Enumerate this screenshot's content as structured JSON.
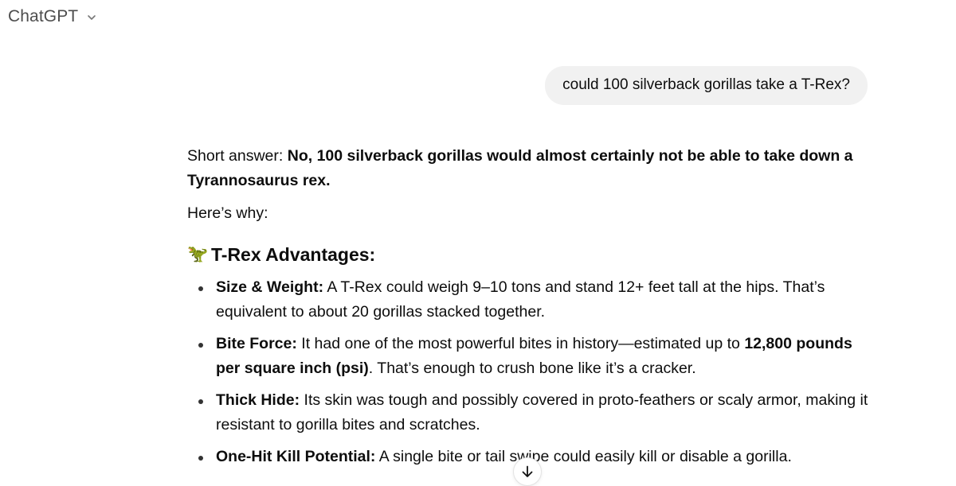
{
  "header": {
    "model_name": "ChatGPT",
    "model_dropdown_icon": "chevron-down-icon"
  },
  "user_message": "could 100 silverback gorillas take a T-Rex?",
  "assistant": {
    "intro_prefix": "Short answer: ",
    "intro_bold": "No, 100 silverback gorillas would almost certainly not be able to take down a Tyrannosaurus rex.",
    "heres_why": "Here’s why:",
    "section_emoji": "🦖",
    "section_title": "T-Rex Advantages:",
    "bullets": [
      {
        "label": "Size & Weight:",
        "text": " A T-Rex could weigh 9–10 tons and stand 12+ feet tall at the hips. That’s equivalent to about 20 gorillas stacked together."
      },
      {
        "label": "Bite Force:",
        "text_before": " It had one of the most powerful bites in history—estimated up to ",
        "bold": "12,800 pounds per square inch (psi)",
        "text_after": ". That’s enough to crush bone like it’s a cracker."
      },
      {
        "label": "Thick Hide:",
        "text": " Its skin was tough and possibly covered in proto-feathers or scaly armor, making it resistant to gorilla bites and scratches."
      },
      {
        "label": "One-Hit Kill Potential:",
        "text": " A single bite or tail swipe could easily kill or disable a gorilla."
      }
    ]
  },
  "scroll_button_icon": "arrow-down-icon"
}
